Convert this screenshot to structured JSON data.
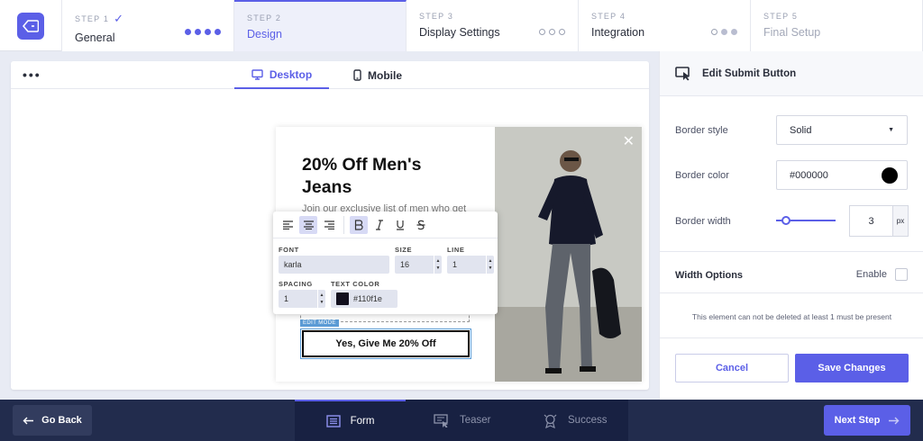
{
  "steps": [
    {
      "num": "STEP 1",
      "check": "✓",
      "name": "General"
    },
    {
      "num": "STEP 2",
      "name": "Design"
    },
    {
      "num": "STEP 3",
      "name": "Display Settings"
    },
    {
      "num": "STEP 4",
      "name": "Integration"
    },
    {
      "num": "STEP 5",
      "name": "Final Setup"
    }
  ],
  "preview": {
    "menu": "•••",
    "tabs": {
      "desktop": "Desktop",
      "mobile": "Mobile"
    },
    "popup": {
      "title": "20% Off Men's Jeans",
      "subtitle": "Join our exclusive list of men who get",
      "close": "✕",
      "edit_mode": "EDIT MODE",
      "cta": "Yes, Give Me 20% Off"
    }
  },
  "text_toolbar": {
    "font_label": "FONT",
    "font": "karla",
    "size_label": "SIZE",
    "size": "16",
    "line_label": "LINE",
    "line": "1",
    "spacing_label": "SPACING",
    "spacing": "1",
    "color_label": "TEXT COLOR",
    "color": "#110f1e"
  },
  "panel": {
    "title": "Edit Submit Button",
    "border_style_label": "Border style",
    "border_style": "Solid",
    "border_color_label": "Border color",
    "border_color": "#000000",
    "border_width_label": "Border width",
    "border_width": "3",
    "border_width_unit": "px",
    "width_options": "Width Options",
    "enable": "Enable",
    "note": "This element can not be deleted at least 1 must be present",
    "cancel": "Cancel",
    "save": "Save Changes"
  },
  "bottom": {
    "back": "Go Back",
    "tabs": {
      "form": "Form",
      "teaser": "Teaser",
      "success": "Success"
    },
    "next": "Next Step"
  },
  "colors": {
    "accent": "#5b5fe7",
    "footer": "#222c4d",
    "text_color": "#110f1e",
    "border_color": "#000000"
  }
}
